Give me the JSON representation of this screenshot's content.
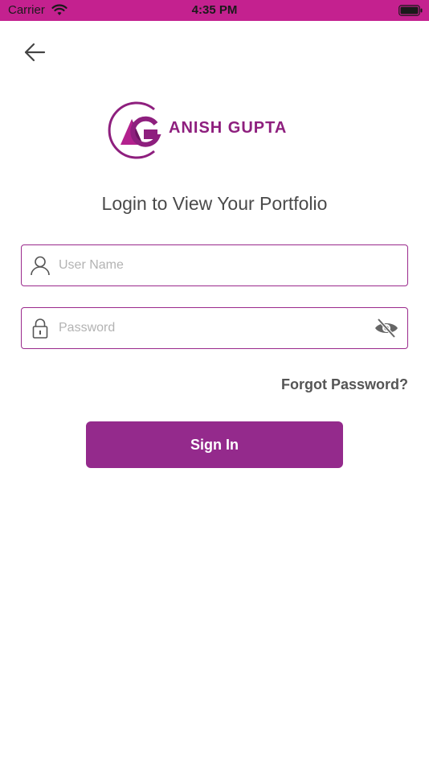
{
  "status_bar": {
    "carrier": "Carrier",
    "time": "4:35 PM",
    "background_color": "#c4218f"
  },
  "header": {
    "back_icon": "arrow-left-icon"
  },
  "logo": {
    "monogram": "AG",
    "brand_name": "ANISH GUPTA",
    "brand_color": "#8e1f7e"
  },
  "page": {
    "title": "Login to View Your Portfolio"
  },
  "form": {
    "username": {
      "placeholder": "User Name",
      "value": "",
      "icon": "user-icon"
    },
    "password": {
      "placeholder": "Password",
      "value": "",
      "icon": "lock-icon",
      "toggle_icon": "eye-off-icon"
    },
    "forgot_password_label": "Forgot Password?",
    "sign_in_label": "Sign In",
    "accent_color": "#942a8c"
  }
}
